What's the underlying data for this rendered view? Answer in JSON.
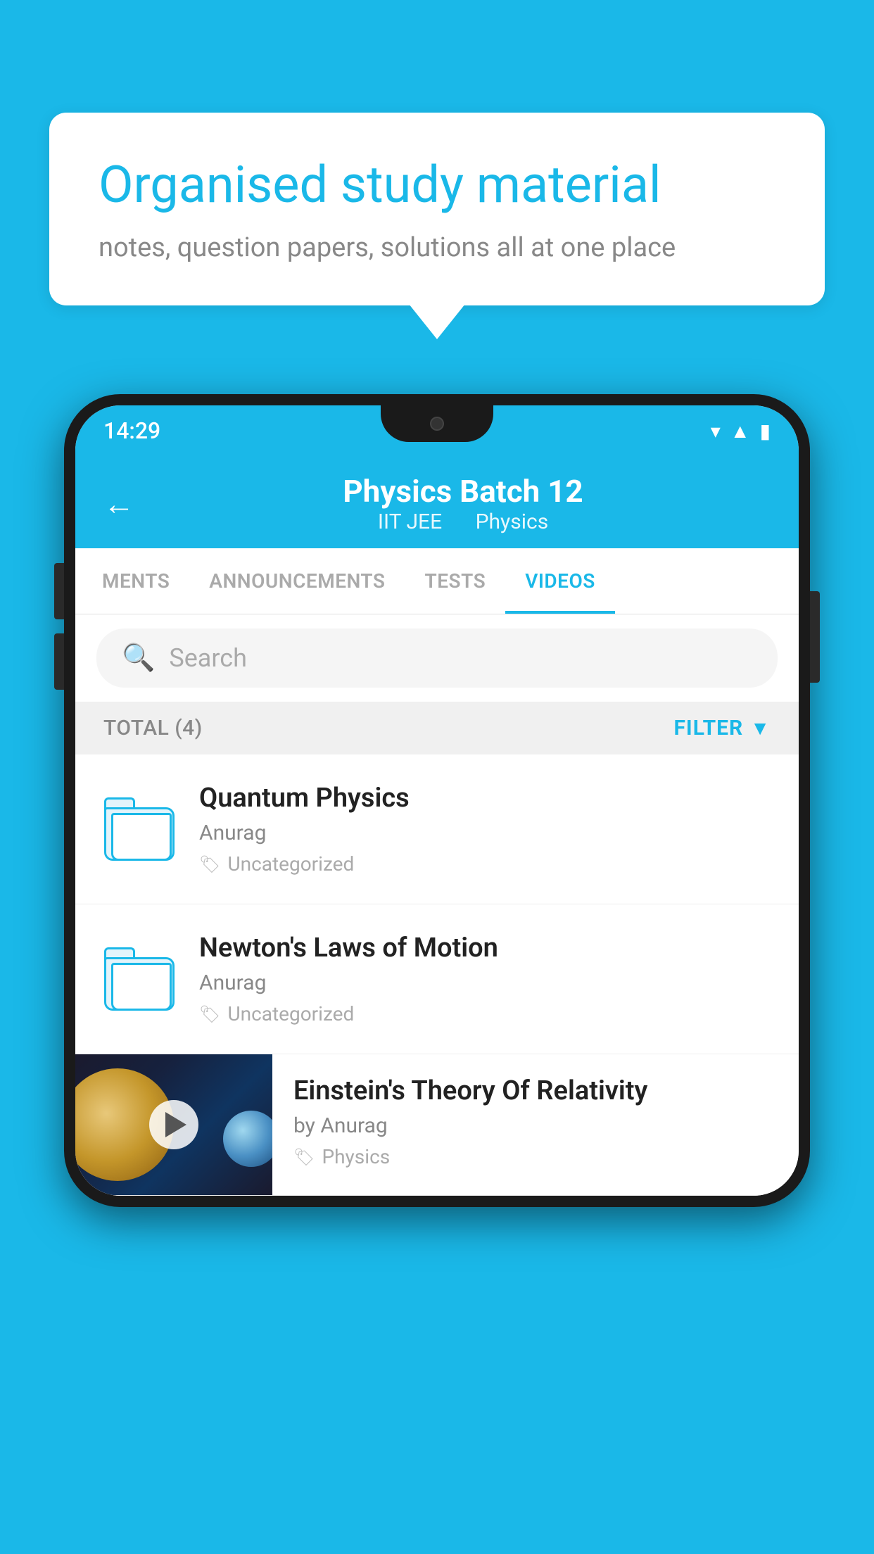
{
  "background": {
    "color": "#1ab8e8"
  },
  "speech_bubble": {
    "title": "Organised study material",
    "subtitle": "notes, question papers, solutions all at one place"
  },
  "phone": {
    "status_bar": {
      "time": "14:29",
      "icons": [
        "wifi",
        "signal",
        "battery"
      ]
    },
    "header": {
      "title": "Physics Batch 12",
      "subtitle_1": "IIT JEE",
      "subtitle_2": "Physics",
      "back_label": "←"
    },
    "tabs": [
      {
        "label": "MENTS",
        "active": false
      },
      {
        "label": "ANNOUNCEMENTS",
        "active": false
      },
      {
        "label": "TESTS",
        "active": false
      },
      {
        "label": "VIDEOS",
        "active": true
      }
    ],
    "search": {
      "placeholder": "Search"
    },
    "filter_bar": {
      "total_label": "TOTAL (4)",
      "filter_label": "FILTER"
    },
    "videos": [
      {
        "title": "Quantum Physics",
        "author": "Anurag",
        "tag": "Uncategorized",
        "type": "folder"
      },
      {
        "title": "Newton's Laws of Motion",
        "author": "Anurag",
        "tag": "Uncategorized",
        "type": "folder"
      },
      {
        "title": "Einstein's Theory Of Relativity",
        "author": "by Anurag",
        "tag": "Physics",
        "type": "video"
      }
    ]
  }
}
